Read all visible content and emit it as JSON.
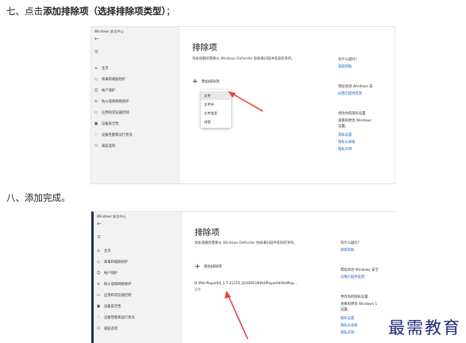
{
  "steps": {
    "s7_pre": "七、点击",
    "s7_bold": "添加排除项（选择排除项类型）",
    "s7_post": "；",
    "s8": "八、添加完成。"
  },
  "window_title": "Windows 安全中心",
  "nav": [
    "主页",
    "病毒和威胁防护",
    "帐户保护",
    "防火墙和网络保护",
    "应用和浏览器控制",
    "设备安全性",
    "设备性能和运行状况",
    "家庭选项"
  ],
  "nav_icons": [
    "home-icon",
    "shield-icon",
    "person-icon",
    "wifi-icon",
    "app-window-icon",
    "laptop-icon",
    "heart-icon",
    "family-icon"
  ],
  "page_title": "排除项",
  "page_desc": "添加或删除需要从 Windows Defender 防病毒扫描中排除的项目。",
  "add_label": "添加排除项",
  "menu": [
    "文件",
    "文件夹",
    "文件类型",
    "进程"
  ],
  "right": {
    "q_title": "有什么疑问?",
    "q_link": "获取帮助",
    "improve_title": "帮助改进 Windows 安全中心",
    "improve_title_cut": "帮助改进 Windows 安",
    "improve_title_cut2": "帮助改进 Windows 安全",
    "improve_link": "向我们提供反馈",
    "privacy_title": "更改你的隐私设置",
    "privacy_desc_1": "查看和更改 Windows 10 设备的隐私",
    "privacy_desc_1_cut": "查看和更改 Windows",
    "privacy_desc_1_cut2": "查看和更改 Windows 1",
    "privacy_desc_2": "设置。",
    "links": [
      "隐私设置",
      "隐私仪表板",
      "隐私声明"
    ]
  },
  "added_item": {
    "path": "D:\\Pot-Player64_1.7.21215_20200519\\PotPlayer64\\PotPlay...",
    "type": "文件"
  },
  "watermark": "最需教育"
}
